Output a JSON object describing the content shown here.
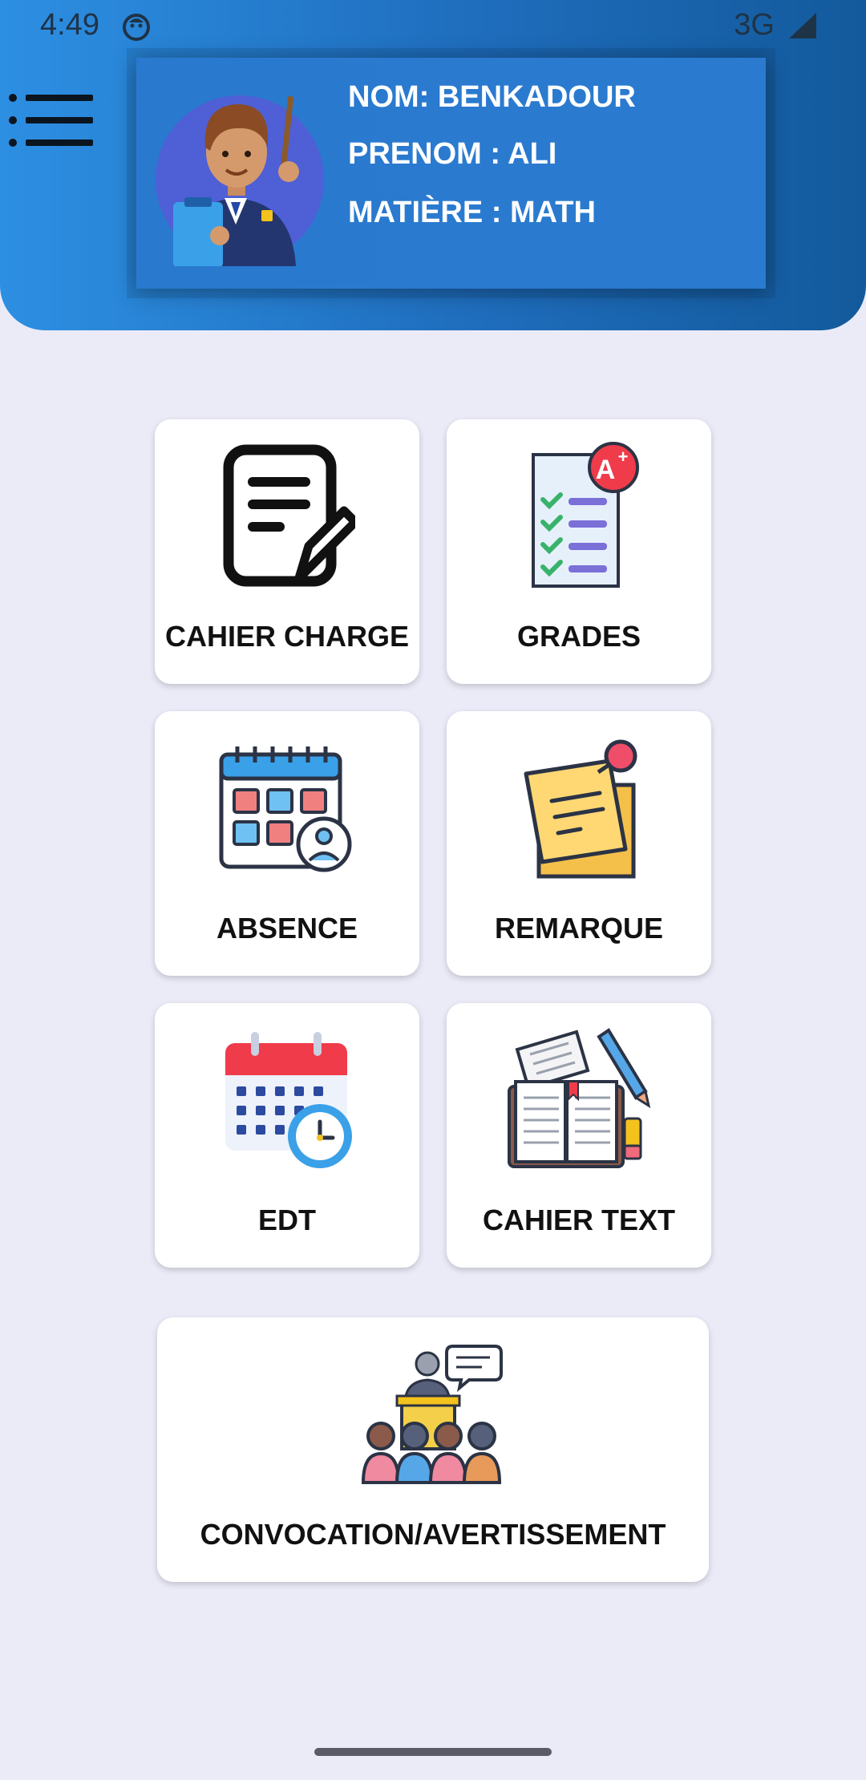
{
  "status_bar": {
    "time": "4:49",
    "network": "3G",
    "icons": [
      "app-notification-icon",
      "signal-icon"
    ]
  },
  "header": {
    "menu_icon": "hamburger-menu-icon",
    "profile": {
      "avatar_icon": "teacher-avatar-icon",
      "nom": "NOM: BENKADOUR",
      "prenom": "PRENOM : ALI",
      "matiere": "MATIÈRE : MATH"
    }
  },
  "menu": {
    "tiles": [
      {
        "label": "CAHIER CHARGE",
        "icon": "document-edit-icon"
      },
      {
        "label": "GRADES",
        "icon": "grades-checklist-icon"
      },
      {
        "label": "ABSENCE",
        "icon": "attendance-calendar-icon"
      },
      {
        "label": "REMARQUE",
        "icon": "sticky-note-icon"
      },
      {
        "label": "EDT",
        "icon": "schedule-calendar-clock-icon"
      },
      {
        "label": "CAHIER TEXT",
        "icon": "open-book-pencil-icon"
      },
      {
        "label": "CONVOCATION/AVERTISSEMENT",
        "icon": "meeting-audience-icon"
      }
    ]
  },
  "colors": {
    "header_start": "#2d8fe2",
    "header_end": "#135a9c",
    "background": "#ebebf8",
    "tile": "#ffffff"
  }
}
